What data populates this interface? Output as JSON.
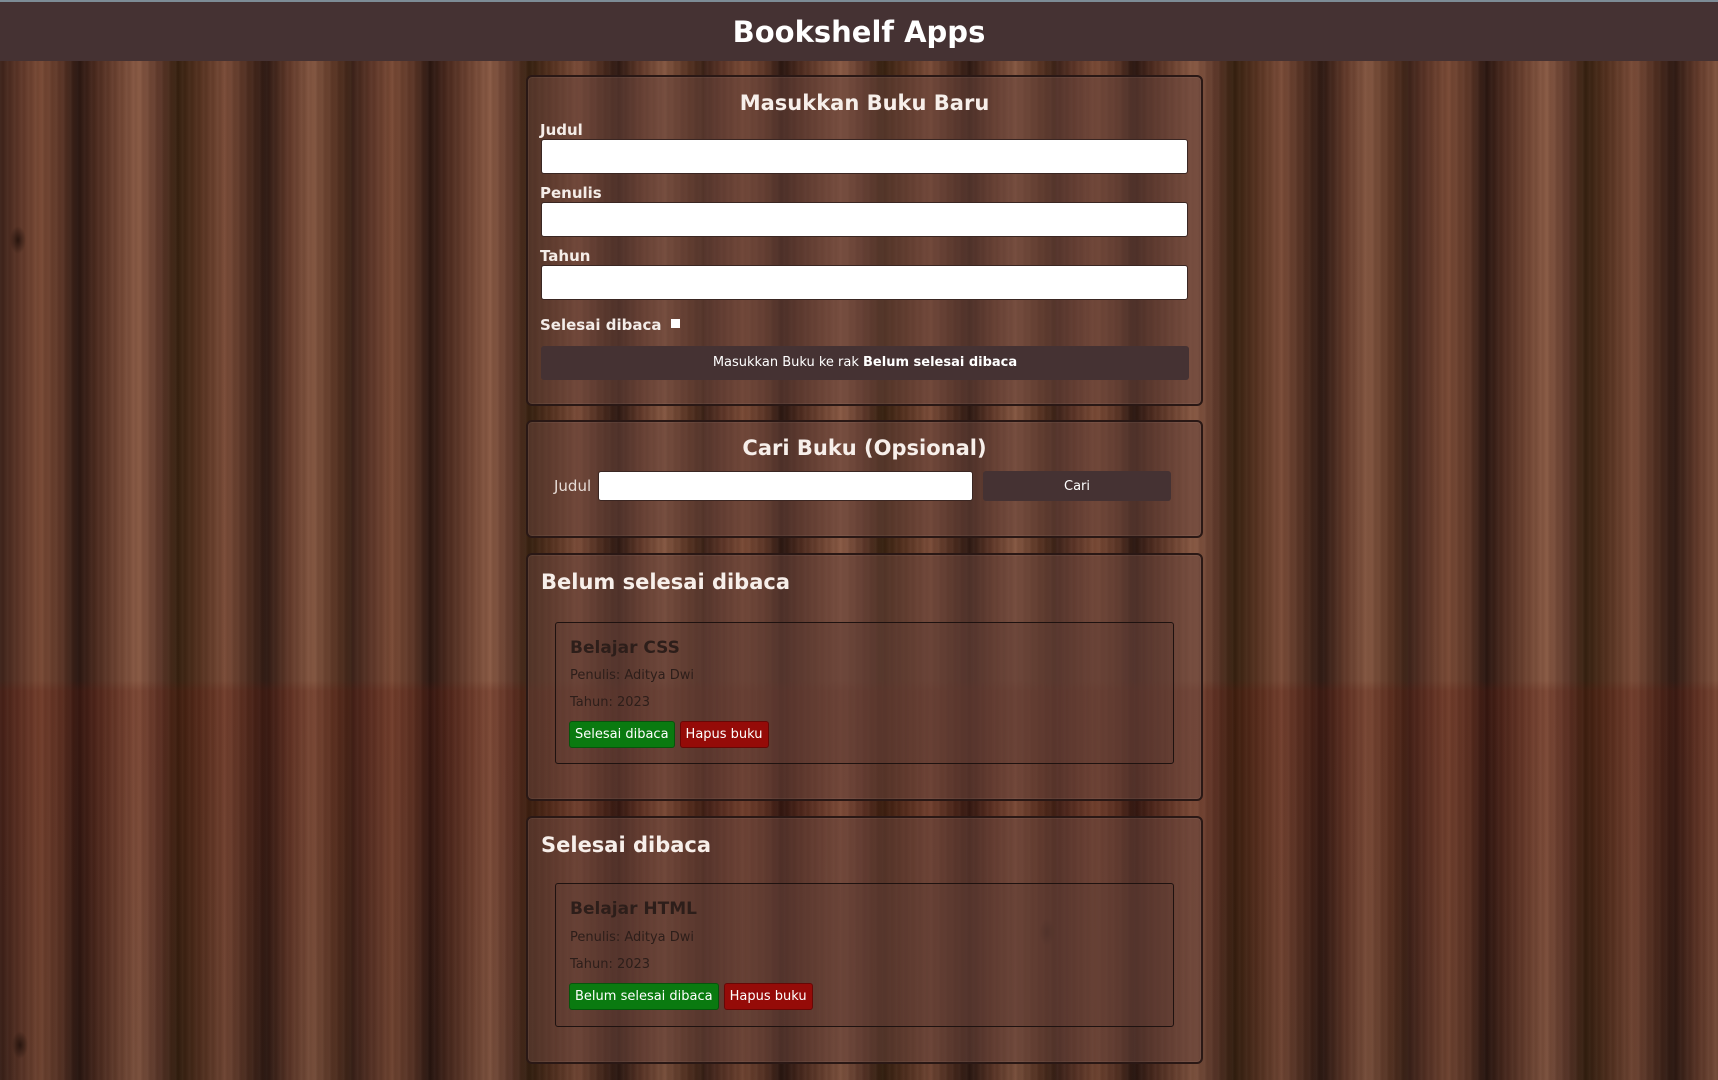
{
  "header": {
    "title": "Bookshelf Apps"
  },
  "input_section": {
    "title": "Masukkan Buku Baru",
    "fields": [
      {
        "label": "Judul",
        "value": ""
      },
      {
        "label": "Penulis",
        "value": ""
      },
      {
        "label": "Tahun",
        "value": ""
      }
    ],
    "complete_label": "Selesai dibaca",
    "complete_checked": false,
    "submit_prefix": "Masukkan Buku ke rak ",
    "submit_target": "Belum selesai dibaca"
  },
  "search_section": {
    "title": "Cari Buku (Opsional)",
    "label": "Judul",
    "value": "",
    "button": "Cari"
  },
  "incomplete_shelf": {
    "title": "Belum selesai dibaca",
    "books": [
      {
        "title": "Belajar CSS",
        "author": "Penulis: Aditya Dwi",
        "year": "Tahun: 2023",
        "toggle_label": "Selesai dibaca",
        "delete_label": "Hapus buku"
      }
    ]
  },
  "complete_shelf": {
    "title": "Selesai dibaca",
    "books": [
      {
        "title": "Belajar HTML",
        "author": "Penulis: Aditya Dwi",
        "year": "Tahun: 2023",
        "toggle_label": "Belum selesai dibaca",
        "delete_label": "Hapus buku"
      }
    ]
  },
  "colors": {
    "header_bg": "#453233",
    "button_dark": "#453233",
    "button_green": "#0a7a10",
    "button_red": "#950b08"
  }
}
